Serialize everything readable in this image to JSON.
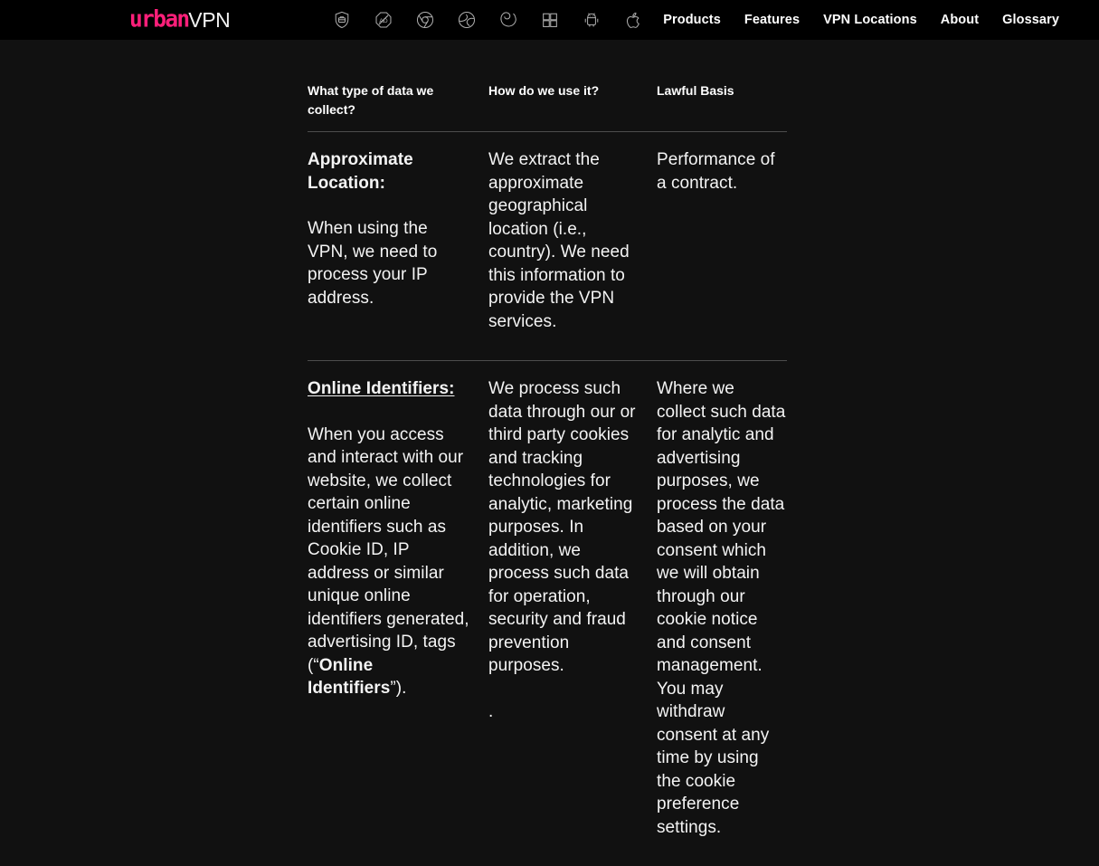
{
  "brand": {
    "logo_primary": "urban",
    "logo_secondary": "VPN"
  },
  "colors": {
    "brand_pink": "#ff1f7a",
    "header_bg": "#000000",
    "page_bg": "#111111",
    "text": "#ffffff",
    "divider": "#4d4d4d"
  },
  "platform_icons": [
    {
      "name": "vpn-shield-icon",
      "label": "VPN"
    },
    {
      "name": "ad-blocker-icon",
      "label": "Ad Blocker"
    },
    {
      "name": "chrome-icon",
      "label": "Chrome"
    },
    {
      "name": "edge-icon",
      "label": "Edge"
    },
    {
      "name": "firefox-icon",
      "label": "Firefox"
    },
    {
      "name": "windows-icon",
      "label": "Windows"
    },
    {
      "name": "android-icon",
      "label": "Android"
    },
    {
      "name": "apple-icon",
      "label": "Apple"
    }
  ],
  "nav": {
    "items": [
      {
        "label": "Products"
      },
      {
        "label": "Features"
      },
      {
        "label": "VPN Locations"
      },
      {
        "label": "About"
      },
      {
        "label": "Glossary"
      }
    ]
  },
  "table": {
    "headers": [
      "What type of data we collect?",
      "How do we use it?",
      "Lawful Basis"
    ],
    "rows": [
      {
        "collect_heading": "Approximate Location:",
        "collect_heading_underlined": false,
        "collect_body": "When using the VPN, we need to process your IP address.",
        "use_body": "We extract the approximate geographical location (i.e., country). We need this information to provide the VPN services.",
        "basis_body": "Performance of a contract.",
        "trailing_dot": ""
      },
      {
        "collect_heading": "Online Identifiers:",
        "collect_heading_underlined": true,
        "collect_body_part1": "When you access and interact with our website, we collect certain online identifiers such as Cookie ID, IP address or similar unique online identifiers generated, advertising ID, tags (“",
        "collect_body_strong": "Online Identifiers",
        "collect_body_part2": "”).",
        "use_body": "We process such data through our or third party cookies and tracking technologies for analytic, marketing purposes. In addition, we process such data for operation, security and fraud prevention purposes.",
        "basis_body": "Where we collect such data for analytic and advertising purposes, we process the data based on your consent which we will obtain through our cookie notice and consent management. You may withdraw consent at any time by using the cookie preference settings.",
        "trailing_dot": "."
      }
    ]
  }
}
